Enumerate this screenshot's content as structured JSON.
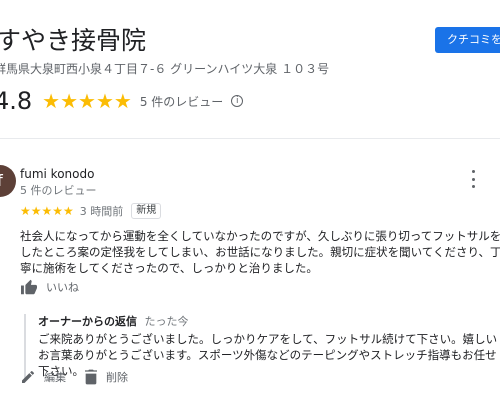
{
  "business": {
    "title": "すやき接骨院",
    "address": "群馬県大泉町西小泉４丁目７-６ グリーンハイツ大泉 １０３号",
    "add_review_label": "クチコミを書く"
  },
  "summary": {
    "rating": "4.8",
    "stars": "★★★★★",
    "review_count": "5 件のレビュー",
    "info_icon": "info-icon"
  },
  "review": {
    "avatar_initial": "f",
    "reviewer_name": "fumi konodo",
    "reviewer_meta": "5 件のレビュー",
    "stars": "★★★★★",
    "rating_value": 5,
    "time": "3 時間前",
    "badge": "新規",
    "text": "社会人になってから運動を全くしていなかったのですが、久しぶりに張り切ってフットサルをしたところ案の定怪我をしてしまい、お世話になりました。親切に症状を聞いてくださり、丁寧に施術をしてくださったので、しっかりと治りました。",
    "like_label": "いいね"
  },
  "reply": {
    "owner_label": "オーナーからの返信",
    "time": "たった今",
    "text": "ご来院ありがとうございました。しっかりケアをして、フットサル続けて下さい。嬉しいお言葉ありがとうございます。スポーツ外傷などのテーピングやストレッチ指導もお任せ下さい。"
  },
  "actions": {
    "edit_label": "編集",
    "delete_label": "削除"
  },
  "colors": {
    "star": "#fbbc04",
    "accent": "#1a73e8",
    "avatar": "#5d4037"
  }
}
